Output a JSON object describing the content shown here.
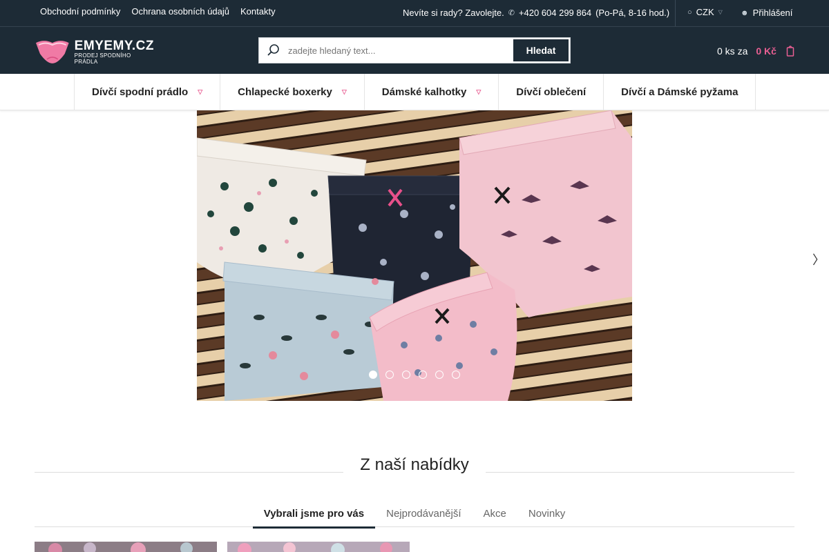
{
  "topbar": {
    "links": [
      "Obchodní podmínky",
      "Ochrana osobních údajů",
      "Kontakty"
    ],
    "help_text": "Nevíte si rady? Zavolejte.",
    "phone": "+420 604 299 864",
    "hours": "(Po-Pá, 8-16 hod.)",
    "currency": "CZK",
    "login": "Přihlášení"
  },
  "header": {
    "logo_brand": "EMYEMY.CZ",
    "logo_tagline": "PRODEJ SPODNÍHO PRÁDLA",
    "search_placeholder": "zadejte hledaný text...",
    "search_button": "Hledat",
    "cart_count": "0 ks za",
    "cart_price": "0 Kč"
  },
  "nav": {
    "items": [
      {
        "label": "Dívčí spodní prádlo",
        "has_dropdown": true
      },
      {
        "label": "Chlapecké boxerky",
        "has_dropdown": true
      },
      {
        "label": "Dámské kalhotky",
        "has_dropdown": true
      },
      {
        "label": "Dívčí oblečení",
        "has_dropdown": false
      },
      {
        "label": "Dívčí a Dámské pyžama",
        "has_dropdown": false
      }
    ]
  },
  "hero": {
    "slide_count": 6,
    "active_slide": 1
  },
  "section": {
    "title": "Z naší nabídky",
    "tabs": [
      "Vybrali jsme pro vás",
      "Nejprodávanější",
      "Akce",
      "Novinky"
    ],
    "active_tab": 0
  },
  "colors": {
    "dark": "#1d2b36",
    "accent": "#e95f93"
  }
}
